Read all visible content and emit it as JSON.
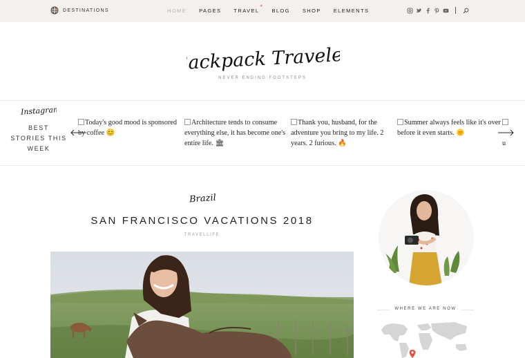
{
  "topbar": {
    "destinations_label": "DESTINATIONS",
    "nav": [
      {
        "label": "HOME",
        "active": true
      },
      {
        "label": "PAGES",
        "active": false
      },
      {
        "label": "TRAVEL",
        "active": false
      },
      {
        "label": "BLOG",
        "active": false
      },
      {
        "label": "SHOP",
        "active": false
      },
      {
        "label": "ELEMENTS",
        "active": false
      }
    ],
    "travel_badge": "*",
    "socials": [
      "instagram-icon",
      "twitter-icon",
      "facebook-icon",
      "pinterest-icon",
      "youtube-icon"
    ],
    "search_icon": "search-icon"
  },
  "header": {
    "logo_text": "Backpack Traveler",
    "tagline": "NEVER ENDING FOOTSTEPS"
  },
  "instagram": {
    "title": "Instagram",
    "lines": [
      "BEST",
      "STORIES THIS",
      "WEEK"
    ],
    "posts": [
      {
        "text": "Today's good mood is sponsored by coffee",
        "emoji": "😊"
      },
      {
        "text": "Architecture tends to consume everything else, it has become one's entire life.",
        "emoji": "🏛"
      },
      {
        "text": "Thank you, husband, for the adventure you bring to my life. 2 years. 2 furious.",
        "emoji": "🔥"
      },
      {
        "text": "Summer always feels like it's over before it even starts.",
        "emoji": "🌞"
      }
    ],
    "next_fragment": "u"
  },
  "post": {
    "category_script": "Brazil",
    "title": "SAN FRANCISCO VACATIONS 2018",
    "category": "TRAVELLIFE"
  },
  "sidebar": {
    "where_title": "WHERE WE ARE NOW"
  },
  "colors": {
    "topbar_bg": "#f4f0ed",
    "accent": "#e0533f",
    "nav_active": "#b8b3ae"
  }
}
